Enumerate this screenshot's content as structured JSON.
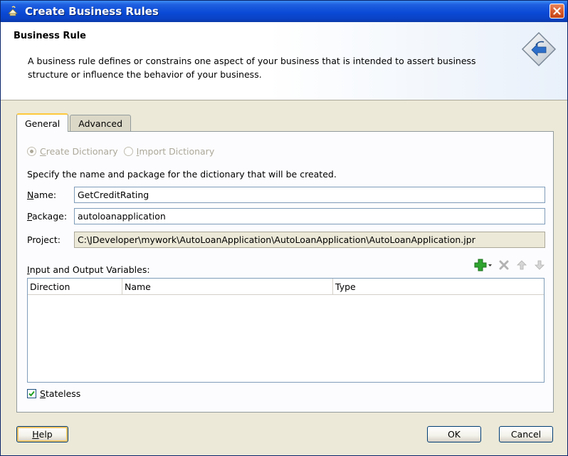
{
  "window": {
    "title": "Create Business Rules"
  },
  "header": {
    "title": "Business Rule",
    "description": "A business rule defines or constrains one aspect of your business that is intended to assert business structure or influence the behavior of your business."
  },
  "tabs": [
    {
      "label": "General",
      "active": true
    },
    {
      "label": "Advanced",
      "active": false
    }
  ],
  "dictionary_options": [
    {
      "label": "Create Dictionary",
      "mnemonic": "C",
      "rest": "reate Dictionary",
      "selected": true,
      "enabled": false
    },
    {
      "label": "Import Dictionary",
      "mnemonic": "I",
      "rest": "mport Dictionary",
      "selected": false,
      "enabled": false
    }
  ],
  "instructions": "Specify the name and package for the dictionary that will be created.",
  "fields": {
    "name": {
      "label_m": "N",
      "label_rest": "ame:",
      "value": "GetCreditRating"
    },
    "package": {
      "label_m": "P",
      "label_rest": "ackage:",
      "value": "autoloanapplication"
    },
    "project": {
      "label": "Project:",
      "value": "C:\\JDeveloper\\mywork\\AutoLoanApplication\\AutoLoanApplication\\AutoLoanApplication.jpr"
    }
  },
  "variables": {
    "label_m": "I",
    "label_rest": "nput and Output Variables:",
    "columns": [
      "Direction",
      "Name",
      "Type"
    ],
    "rows": []
  },
  "stateless": {
    "label_m": "S",
    "label_rest": "tateless",
    "checked": true
  },
  "buttons": {
    "help_m": "H",
    "help_rest": "elp",
    "ok": "OK",
    "cancel": "Cancel"
  },
  "colors": {
    "titlebar": "#0a4ad6",
    "add_icon": "#2fa52f",
    "dialog_bg": "#ece9d8"
  }
}
